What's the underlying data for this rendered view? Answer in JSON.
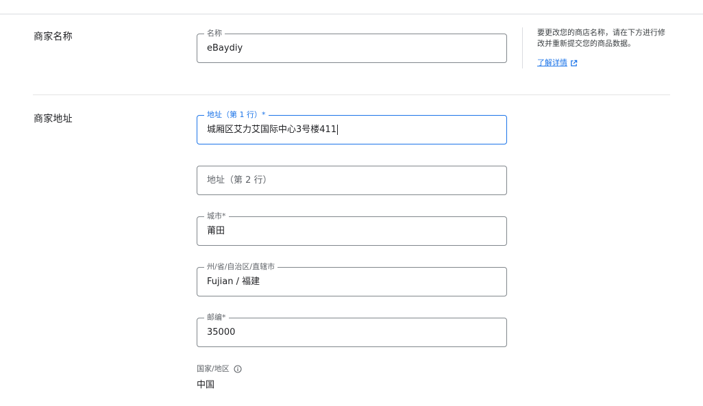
{
  "business_name_section": {
    "title": "商家名称",
    "name_field": {
      "label": "名称",
      "value": "eBaydiy"
    },
    "help": {
      "text": "要更改您的商店名称，请在下方进行修改并重新提交您的商品数据。",
      "link_label": "了解详情",
      "link_icon": "external-link-icon"
    }
  },
  "business_address_section": {
    "title": "商家地址",
    "address_line1": {
      "label": "地址（第 1 行）*",
      "value": "城厢区艾力艾国际中心3号楼411"
    },
    "address_line2": {
      "placeholder": "地址（第 2 行）"
    },
    "city": {
      "label": "城市*",
      "value": "莆田"
    },
    "state": {
      "label": "州/省/自治区/直辖市",
      "value": "Fujian / 福建"
    },
    "postal_code": {
      "label": "邮编*",
      "value": "35000"
    },
    "country": {
      "label": "国家/地区",
      "value": "中国",
      "info_icon": "info-icon"
    }
  },
  "colors": {
    "accent": "#1a73e8",
    "border": "#80868b",
    "divider": "#dadce0"
  }
}
